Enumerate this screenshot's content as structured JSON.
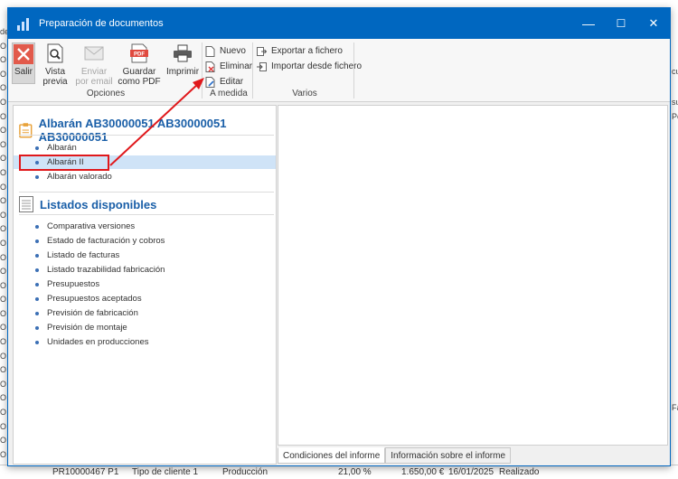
{
  "background": {
    "left_fragments": [
      "de",
      "O",
      "O",
      "O",
      "O",
      "O",
      "O",
      "O",
      "O",
      "O",
      "O",
      "O",
      "O",
      "O",
      "O",
      "O",
      "O",
      "O",
      "O",
      "O",
      "O",
      "O",
      "O",
      "O",
      "O",
      "O",
      "O",
      "O",
      "O",
      "O",
      "O",
      "O"
    ],
    "right_fragments": [
      "cu",
      "su",
      "Pe",
      "Fa"
    ],
    "bottom_row": [
      "PR10000467 P1",
      "Tipo de cliente 1",
      "Producción",
      "21,00 %",
      "1.650,00 €",
      "16/01/2025",
      "Realizado"
    ]
  },
  "window": {
    "title": "Preparación de documentos",
    "minimize": "—",
    "maximize": "☐",
    "close": "✕"
  },
  "ribbon": {
    "salir": "Salir",
    "vista_previa": "Vista previa",
    "enviar_email": "Enviar por email",
    "guardar_pdf": "Guardar como PDF",
    "imprimir": "Imprimir",
    "nuevo": "Nuevo",
    "eliminar": "Eliminar",
    "editar": "Editar",
    "exportar": "Exportar a fichero",
    "importar": "Importar desde fichero",
    "groups": [
      "Opciones",
      "A medida",
      "Varios"
    ]
  },
  "albaran_section": {
    "title": "Albarán AB30000051 AB30000051 AB30000051",
    "items": [
      "Albarán",
      "Albarán II",
      "Albarán valorado"
    ],
    "selected_index": 1
  },
  "listados_section": {
    "title": "Listados disponibles",
    "items": [
      "Comparativa versiones",
      "Estado de facturación y cobros",
      "Listado de facturas",
      "Listado trazabilidad fabricación",
      "Presupuestos",
      "Presupuestos aceptados",
      "Previsión de fabricación",
      "Previsión de montaje",
      "Unidades en producciones"
    ]
  },
  "tabs": [
    "Condiciones del informe",
    "Información sobre el informe"
  ],
  "colors": {
    "titlebar": "#0067c0",
    "accent": "#1a5fa8",
    "selected_row": "#cfe3f7",
    "annotation_red": "#e0181b"
  }
}
